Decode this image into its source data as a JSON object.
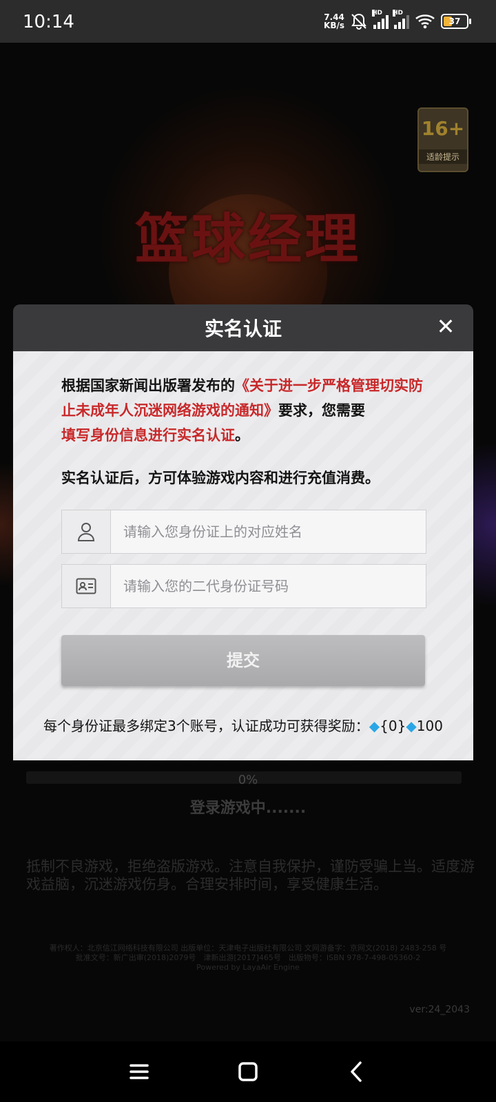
{
  "status_bar": {
    "time": "10:14",
    "net_speed_value": "7.44",
    "net_speed_unit": "KB/s",
    "hd_label": "HD",
    "battery": "37",
    "battery_color": "#f2b339"
  },
  "game": {
    "logo_text": "篮球经理",
    "age_rating": "16+",
    "age_label": "适龄提示",
    "progress": "0%",
    "progress_value": 0,
    "loading_text": "登录游戏中.......",
    "health_notice": "抵制不良游戏，拒绝盗版游戏。注意自我保护，谨防受骗上当。适度游戏益脑，沉迷游戏伤身。合理安排时间，享受健康生活。",
    "copyright_line1": "著作权人：北京信江网络科技有限公司 出版单位：天津电子出版社有限公司 文网游备字：京网文(2018) 2483-258 号",
    "copyright_line2": "批准文号：新广出审(2018)2079号　津新出游[2017]465号　出版物号：ISBN 978-7-498-05360-2",
    "copyright_line3": "Powered by LayaAir Engine",
    "version": "ver:24_2043"
  },
  "modal": {
    "title": "实名认证",
    "close_icon": "✕",
    "notice_part1": "根据国家新闻出版署发布的",
    "notice_link": "《关于进一步严格管理切实防止未成年人沉迷网络游戏的通知》",
    "notice_part2": "要求，您需要",
    "notice_highlight": "填写身份信息进行实名认证",
    "notice_end": "。",
    "notice2": "实名认证后，方可体验游戏内容和进行充值消费。",
    "name_field": {
      "value": "",
      "placeholder": "请输入您身份证上的对应姓名",
      "icon": "person-icon"
    },
    "id_field": {
      "value": "",
      "placeholder": "请输入您的二代身份证号码",
      "icon": "id-card-icon"
    },
    "submit_label": "提交",
    "reward_text": "每个身份证最多绑定3个账号，认证成功可获得奖励：",
    "reward_item1": "{0}",
    "reward_item2": "100",
    "accent_red": "#c8282a"
  },
  "nav": {
    "menu_icon": "menu-icon",
    "home_icon": "home-icon",
    "back_icon": "back-icon"
  }
}
